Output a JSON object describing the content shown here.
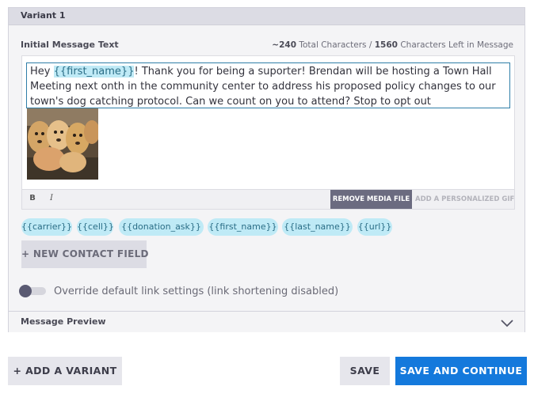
{
  "variant": {
    "title": "Variant 1",
    "message_label": "Initial Message Text",
    "char_count": {
      "total": "~240",
      "total_label": "Total Characters /",
      "left": "1560",
      "left_label": "Characters Left in Message"
    },
    "message": {
      "before_token": "Hey ",
      "token": "{{first_name}}",
      "after_token": "! Thank you for being a suporter! Brendan will be hosting a Town Hall Meeting next onth in the community center to address his proposed policy changes to our town's dog catching protocol. Can we count on you to attend? Stop to opt out"
    },
    "toolbar": {
      "bold": "B",
      "italic": "I",
      "remove_media": "REMOVE MEDIA FILE",
      "add_gif": "ADD A PERSONALIZED GIF"
    },
    "contact_fields": [
      "{{carrier}}",
      "{{cell}}",
      "{{donation_ask}}",
      "{{first_name}}",
      "{{last_name}}",
      "{{url}}"
    ],
    "new_field_label": "+ NEW CONTACT FIELD",
    "toggle": {
      "label": "Override default link settings (link shortening disabled)",
      "on": false
    },
    "preview_label": "Message Preview"
  },
  "actions": {
    "add_variant": "+ ADD A VARIANT",
    "save": "SAVE",
    "save_continue": "SAVE AND CONTINUE"
  },
  "colors": {
    "primary": "#1479dc",
    "token_bg": "#bfeaf6",
    "token_text": "#2a6d86",
    "remove_media_bg": "#6b6b80"
  },
  "icons": {
    "preview_toggle": "chevron-down-icon",
    "media": "attached-image-puppies"
  }
}
